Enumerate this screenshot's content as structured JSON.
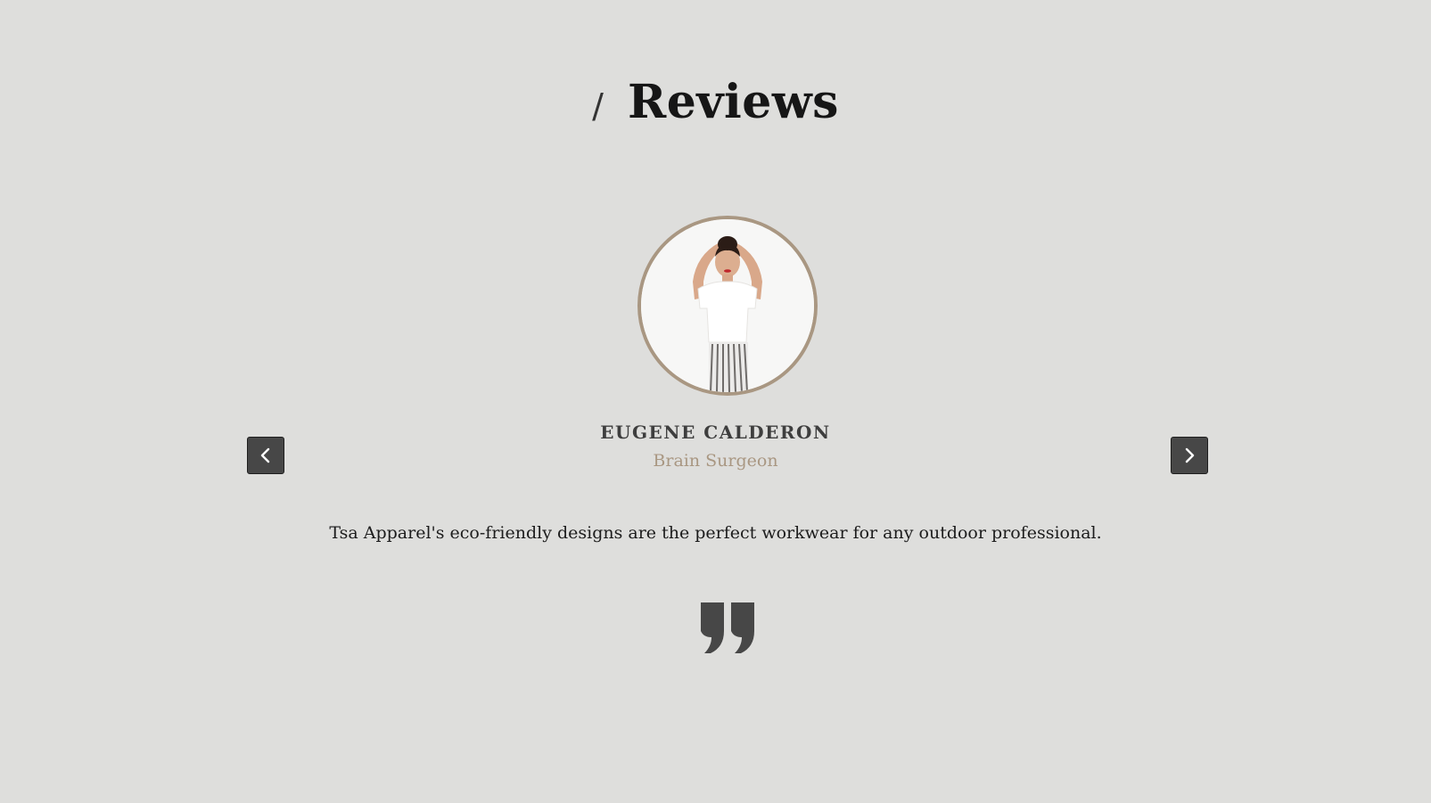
{
  "section": {
    "slash": "/",
    "title": "Reviews"
  },
  "review": {
    "name": "EUGENE CALDERON",
    "role": "Brain Surgeon",
    "text": "Tsa Apparel's eco-friendly designs are the perfect workwear for any outdoor professional."
  },
  "controls": {
    "prev_icon": "chevron-left-icon",
    "next_icon": "chevron-right-icon"
  },
  "colors": {
    "background": "#dededc",
    "accent": "#a99782",
    "button": "#474747",
    "heading": "#161616"
  }
}
